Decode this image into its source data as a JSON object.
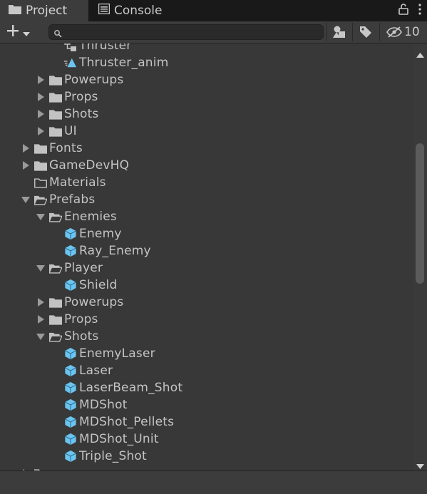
{
  "tabs": [
    {
      "label": "Project",
      "icon": "folder-icon",
      "active": true
    },
    {
      "label": "Console",
      "icon": "console-icon",
      "active": false
    }
  ],
  "toolbar": {
    "search_value": "",
    "search_placeholder": "",
    "hidden_count": "10"
  },
  "colors": {
    "background": "#383838",
    "tab_bar": "#191919",
    "prefab_icon": "#6bc4ef",
    "folder_icon": "#c2c2c2"
  },
  "tree": [
    {
      "label": "Thruster",
      "depth": 3,
      "icon": "animator-controller-icon",
      "expander": "none"
    },
    {
      "label": "Thruster_anim",
      "depth": 3,
      "icon": "animation-clip-icon",
      "expander": "none"
    },
    {
      "label": "Powerups",
      "depth": 2,
      "icon": "folder-icon",
      "expander": "collapsed"
    },
    {
      "label": "Props",
      "depth": 2,
      "icon": "folder-icon",
      "expander": "collapsed"
    },
    {
      "label": "Shots",
      "depth": 2,
      "icon": "folder-icon",
      "expander": "collapsed"
    },
    {
      "label": "UI",
      "depth": 2,
      "icon": "folder-icon",
      "expander": "collapsed"
    },
    {
      "label": "Fonts",
      "depth": 1,
      "icon": "folder-icon",
      "expander": "collapsed"
    },
    {
      "label": "GameDevHQ",
      "depth": 1,
      "icon": "folder-icon",
      "expander": "collapsed"
    },
    {
      "label": "Materials",
      "depth": 1,
      "icon": "empty-folder-icon",
      "expander": "none"
    },
    {
      "label": "Prefabs",
      "depth": 1,
      "icon": "open-folder-icon",
      "expander": "expanded"
    },
    {
      "label": "Enemies",
      "depth": 2,
      "icon": "open-folder-icon",
      "expander": "expanded"
    },
    {
      "label": "Enemy",
      "depth": 3,
      "icon": "prefab-icon",
      "expander": "none"
    },
    {
      "label": "Ray_Enemy",
      "depth": 3,
      "icon": "prefab-icon",
      "expander": "none"
    },
    {
      "label": "Player",
      "depth": 2,
      "icon": "open-folder-icon",
      "expander": "expanded"
    },
    {
      "label": "Shield",
      "depth": 3,
      "icon": "prefab-icon",
      "expander": "none"
    },
    {
      "label": "Powerups",
      "depth": 2,
      "icon": "folder-icon",
      "expander": "collapsed"
    },
    {
      "label": "Props",
      "depth": 2,
      "icon": "folder-icon",
      "expander": "collapsed"
    },
    {
      "label": "Shots",
      "depth": 2,
      "icon": "open-folder-icon",
      "expander": "expanded"
    },
    {
      "label": "EnemyLaser",
      "depth": 3,
      "icon": "prefab-icon",
      "expander": "none"
    },
    {
      "label": "Laser",
      "depth": 3,
      "icon": "prefab-icon",
      "expander": "none"
    },
    {
      "label": "LaserBeam_Shot",
      "depth": 3,
      "icon": "prefab-icon",
      "expander": "none"
    },
    {
      "label": "MDShot",
      "depth": 3,
      "icon": "prefab-icon",
      "expander": "none"
    },
    {
      "label": "MDShot_Pellets",
      "depth": 3,
      "icon": "prefab-icon",
      "expander": "none"
    },
    {
      "label": "MDShot_Unit",
      "depth": 3,
      "icon": "prefab-icon",
      "expander": "none"
    },
    {
      "label": "Triple_Shot",
      "depth": 3,
      "icon": "prefab-icon",
      "expander": "none"
    },
    {
      "label": "",
      "depth": 1,
      "icon": "folder-icon",
      "expander": "collapsed"
    }
  ]
}
